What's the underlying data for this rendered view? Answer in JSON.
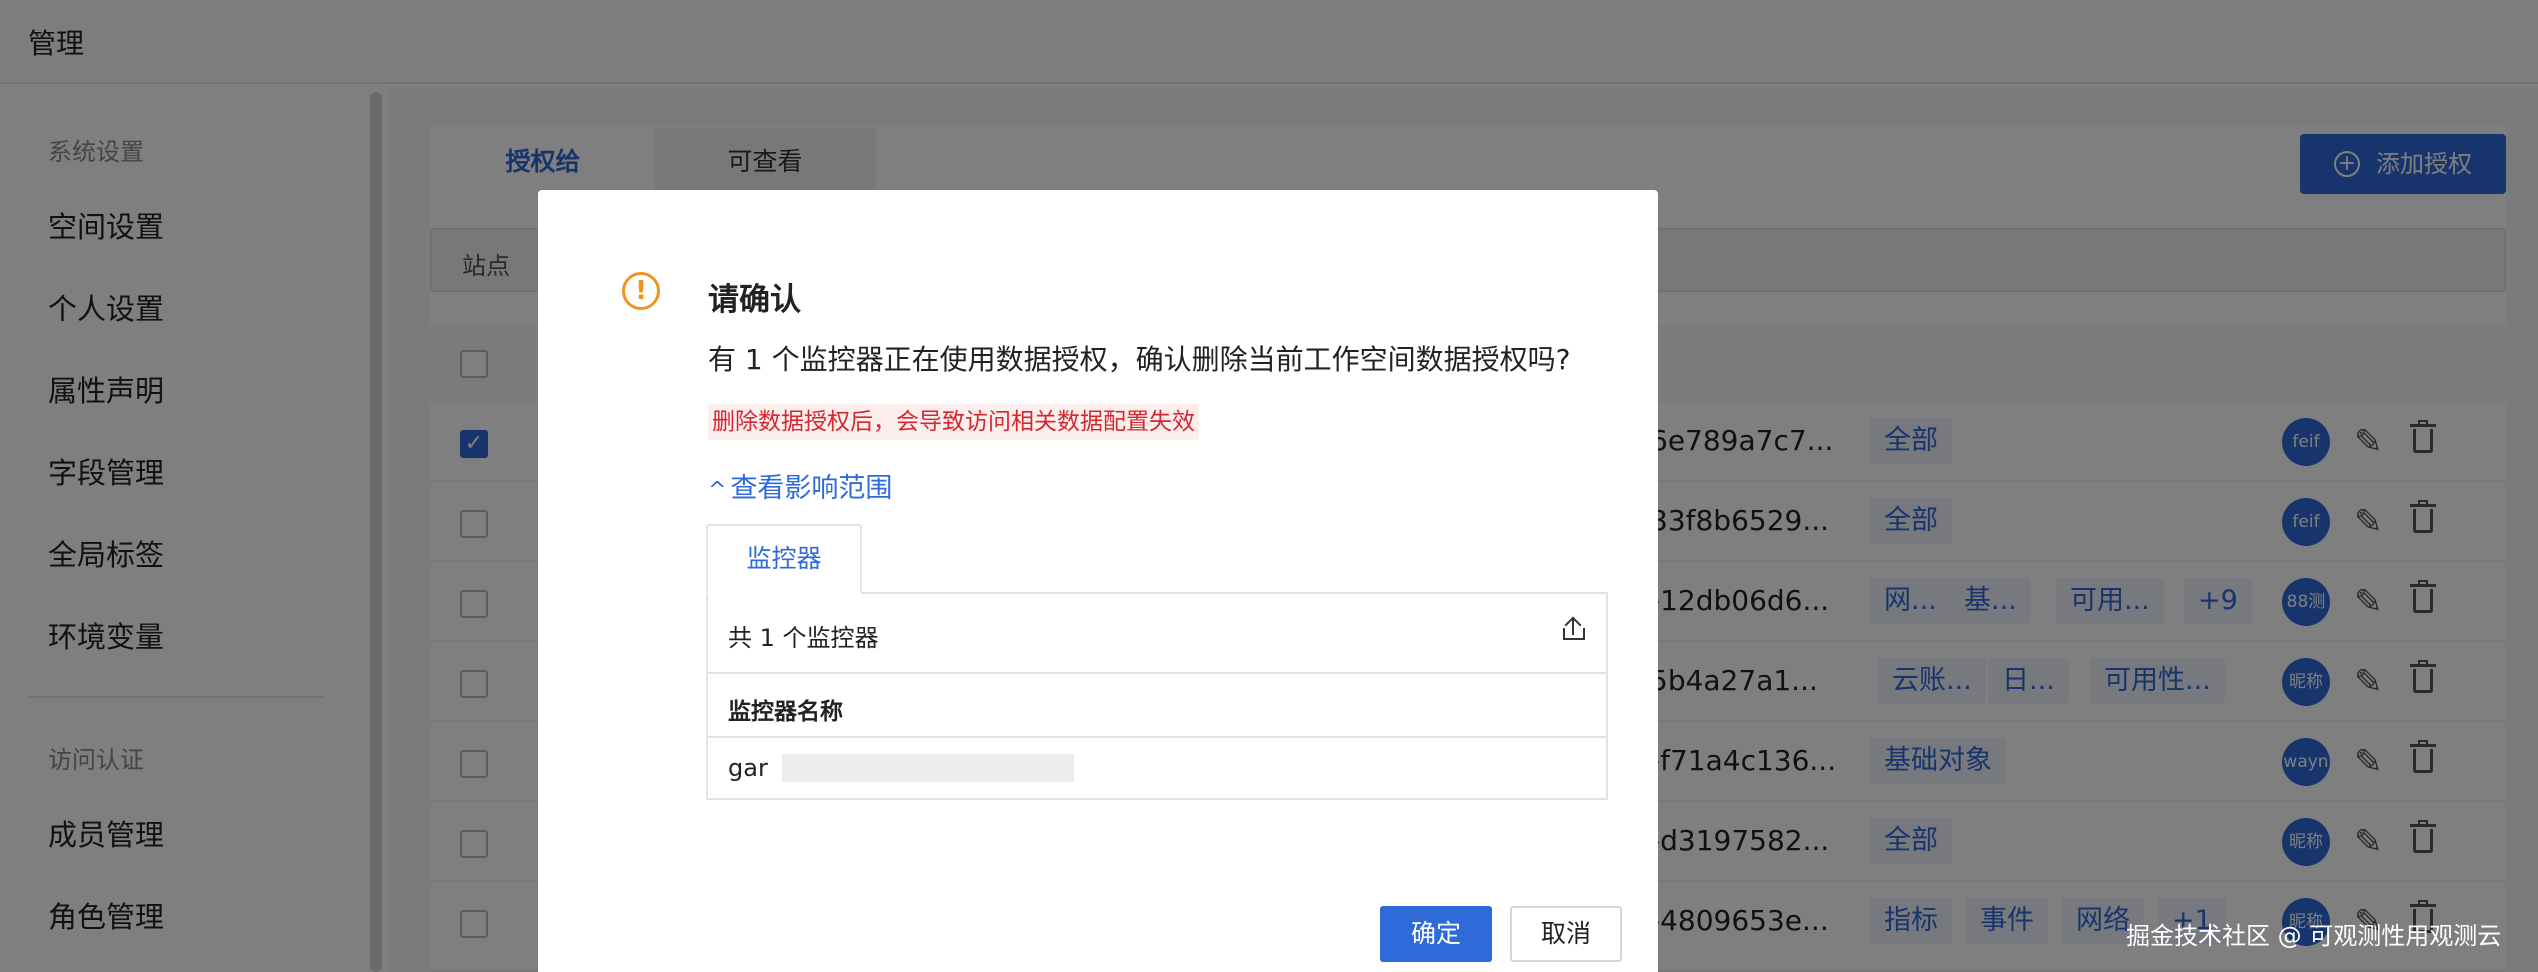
{
  "app": {
    "title": "管理"
  },
  "sidebar": {
    "group1": "系统设置",
    "items1": [
      "空间设置",
      "个人设置",
      "属性声明",
      "字段管理",
      "全局标签",
      "环境变量"
    ],
    "group2": "访问认证",
    "items2": [
      "成员管理",
      "角色管理"
    ]
  },
  "main": {
    "tabs": [
      "授权给",
      "可查看"
    ],
    "add_button": "添加授权",
    "filter_label": "站点",
    "rows": [
      {
        "checked": true,
        "id": "6e789a7c7...",
        "tags": [
          "全部"
        ],
        "avatar": "feif"
      },
      {
        "checked": false,
        "id": "33f8b6529...",
        "tags": [
          "全部"
        ],
        "avatar": "feif"
      },
      {
        "checked": false,
        "id": "-12db06d6...",
        "tags": [
          "网...",
          "基...",
          "可用...",
          "+9"
        ],
        "avatar": "88测"
      },
      {
        "checked": false,
        "id": "5b4a27a1...",
        "tags": [
          "云账...",
          "日...",
          "可用性..."
        ],
        "avatar": "昵称"
      },
      {
        "checked": false,
        "id": "-f71a4c136...",
        "tags": [
          "基础对象"
        ],
        "avatar": "wayn"
      },
      {
        "checked": false,
        "id": "-d3197582...",
        "tags": [
          "全部"
        ],
        "avatar": "昵称"
      },
      {
        "checked": false,
        "id": "-4809653e...",
        "tags": [
          "指标",
          "事件",
          "网络",
          "+1"
        ],
        "avatar": "昵称"
      }
    ]
  },
  "modal": {
    "title": "请确认",
    "message": "有 1 个监控器正在使用数据授权，确认删除当前工作空间数据授权吗?",
    "warning": "删除数据授权后，会导致访问相关数据配置失效",
    "scope_link": "查看影响范围",
    "tab": "监控器",
    "count": "共 1 个监控器",
    "column": "监控器名称",
    "row_value": "gar",
    "confirm": "确定",
    "cancel": "取消"
  },
  "watermark": "掘金技术社区 @ 可观测性用观测云",
  "colors": {
    "accent": "#2f6bd8",
    "warning": "#f0941f",
    "danger": "#d4282f"
  },
  "icons": {
    "warning": "warning-circle-icon",
    "export": "export-icon",
    "edit": "pencil-icon",
    "delete": "trash-icon",
    "add": "plus-circle-icon"
  }
}
